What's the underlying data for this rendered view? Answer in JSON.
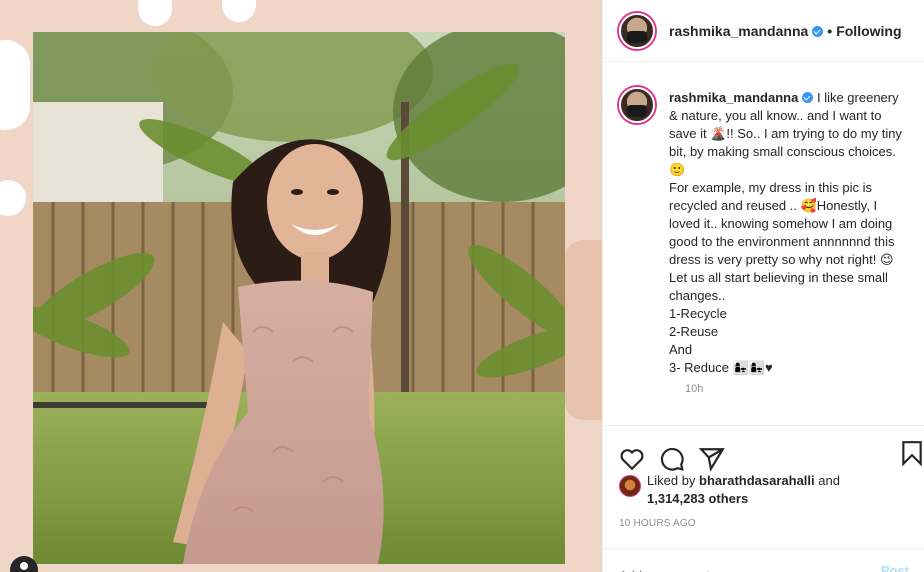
{
  "post": {
    "username": "rashmika_mandanna",
    "follow_status": "Following",
    "separator": "•"
  },
  "caption": {
    "username": "rashmika_mandanna",
    "text": "I like greenery & nature, you all know.. and I want to save it 🌋!! So.. I am trying to do my tiny bit, by making small conscious choices. 🙂\nFor example, my dress in this pic is recycled and reused .. 🥰Honestly, I loved it.. knowing somehow I am doing good to the environment annnnnnd this dress is very pretty so why not right! 😉\nLet us all start believing in these small changes..\n1-Recycle\n2-Reuse\nAnd\n3- Reduce 👩‍👧👩‍👧♥",
    "time": "10h"
  },
  "likes": {
    "prefix": "Liked by",
    "user": "bharathdasarahalli",
    "connector": "and",
    "count": "1,314,283 others"
  },
  "timestamp": "10 HOURS AGO",
  "comment_box": {
    "placeholder": "Add a comment...",
    "post_label": "Post"
  },
  "icons": {
    "like": "heart-icon",
    "comment": "comment-icon",
    "share": "share-icon",
    "save": "bookmark-icon",
    "verified": "verified-badge-icon"
  },
  "colors": {
    "verified": "#3897f0",
    "story_ring": "#e0338e",
    "muted_text": "#8e8e8e",
    "post_button": "#b2dffc"
  }
}
